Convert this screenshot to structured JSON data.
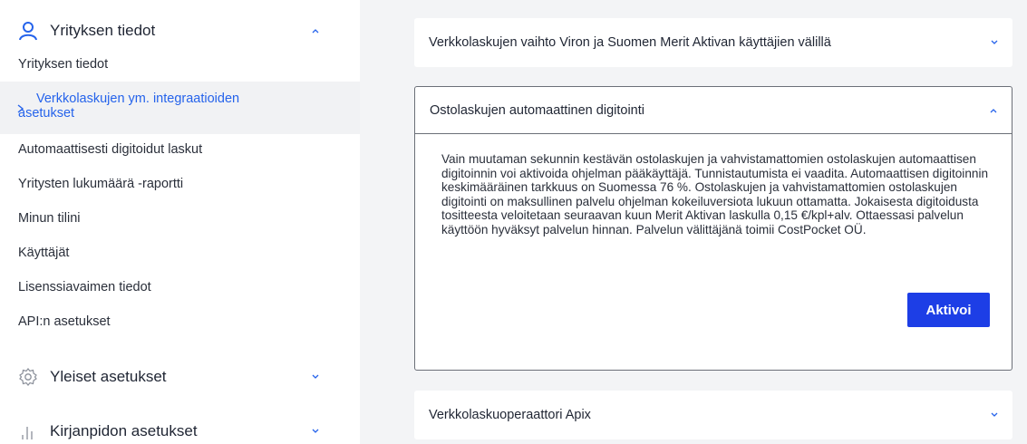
{
  "sidebar": {
    "sections": [
      {
        "label": "Yrityksen tiedot",
        "icon": "user-icon",
        "expanded": true
      },
      {
        "label": "Yleiset asetukset",
        "icon": "gear-icon",
        "expanded": false
      },
      {
        "label": "Kirjanpidon asetukset",
        "icon": "bar-chart-icon",
        "expanded": false
      }
    ],
    "items": [
      {
        "label": "Yrityksen tiedot"
      },
      {
        "label": "Verkkolaskujen ym. integraatioiden asetukset",
        "active": true
      },
      {
        "label": "Automaattisesti digitoidut laskut"
      },
      {
        "label": "Yritysten lukumäärä -raportti"
      },
      {
        "label": "Minun tilini"
      },
      {
        "label": "Käyttäjät"
      },
      {
        "label": "Lisenssiavaimen tiedot"
      },
      {
        "label": "API:n asetukset"
      }
    ]
  },
  "main": {
    "cards": [
      {
        "title": "Verkkolaskujen vaihto Viron ja Suomen Merit Aktivan käyttäjien välillä",
        "expanded": false
      },
      {
        "title": "Ostolaskujen automaattinen digitointi",
        "expanded": true,
        "body": "Vain muutaman sekunnin kestävän ostolaskujen ja vahvistamattomien ostolaskujen automaattisen digitoinnin voi aktivoida ohjelman pääkäyttäjä. Tunnistautumista ei vaadita. Automaattisen digitoinnin keskimääräinen tarkkuus on Suomessa 76 %. Ostolaskujen ja vahvistamattomien ostolaskujen digitointi on maksullinen palvelu ohjelman kokeiluversiota lukuun ottamatta. Jokaisesta digitoidusta tositteesta veloitetaan seuraavan kuun Merit Aktivan laskulla 0,15 €/kpl+alv. Ottaessasi palvelun käyttöön hyväksyt palvelun hinnan. Palvelun välittäjänä toimii CostPocket OÜ.",
        "button_label": "Aktivoi"
      },
      {
        "title": "Verkkolaskuoperaattori Apix",
        "expanded": false
      }
    ]
  },
  "colors": {
    "accent": "#2563eb",
    "button": "#1d3ee6",
    "main_bg": "#f3f4f6",
    "active_bg": "#f1f2f4"
  }
}
